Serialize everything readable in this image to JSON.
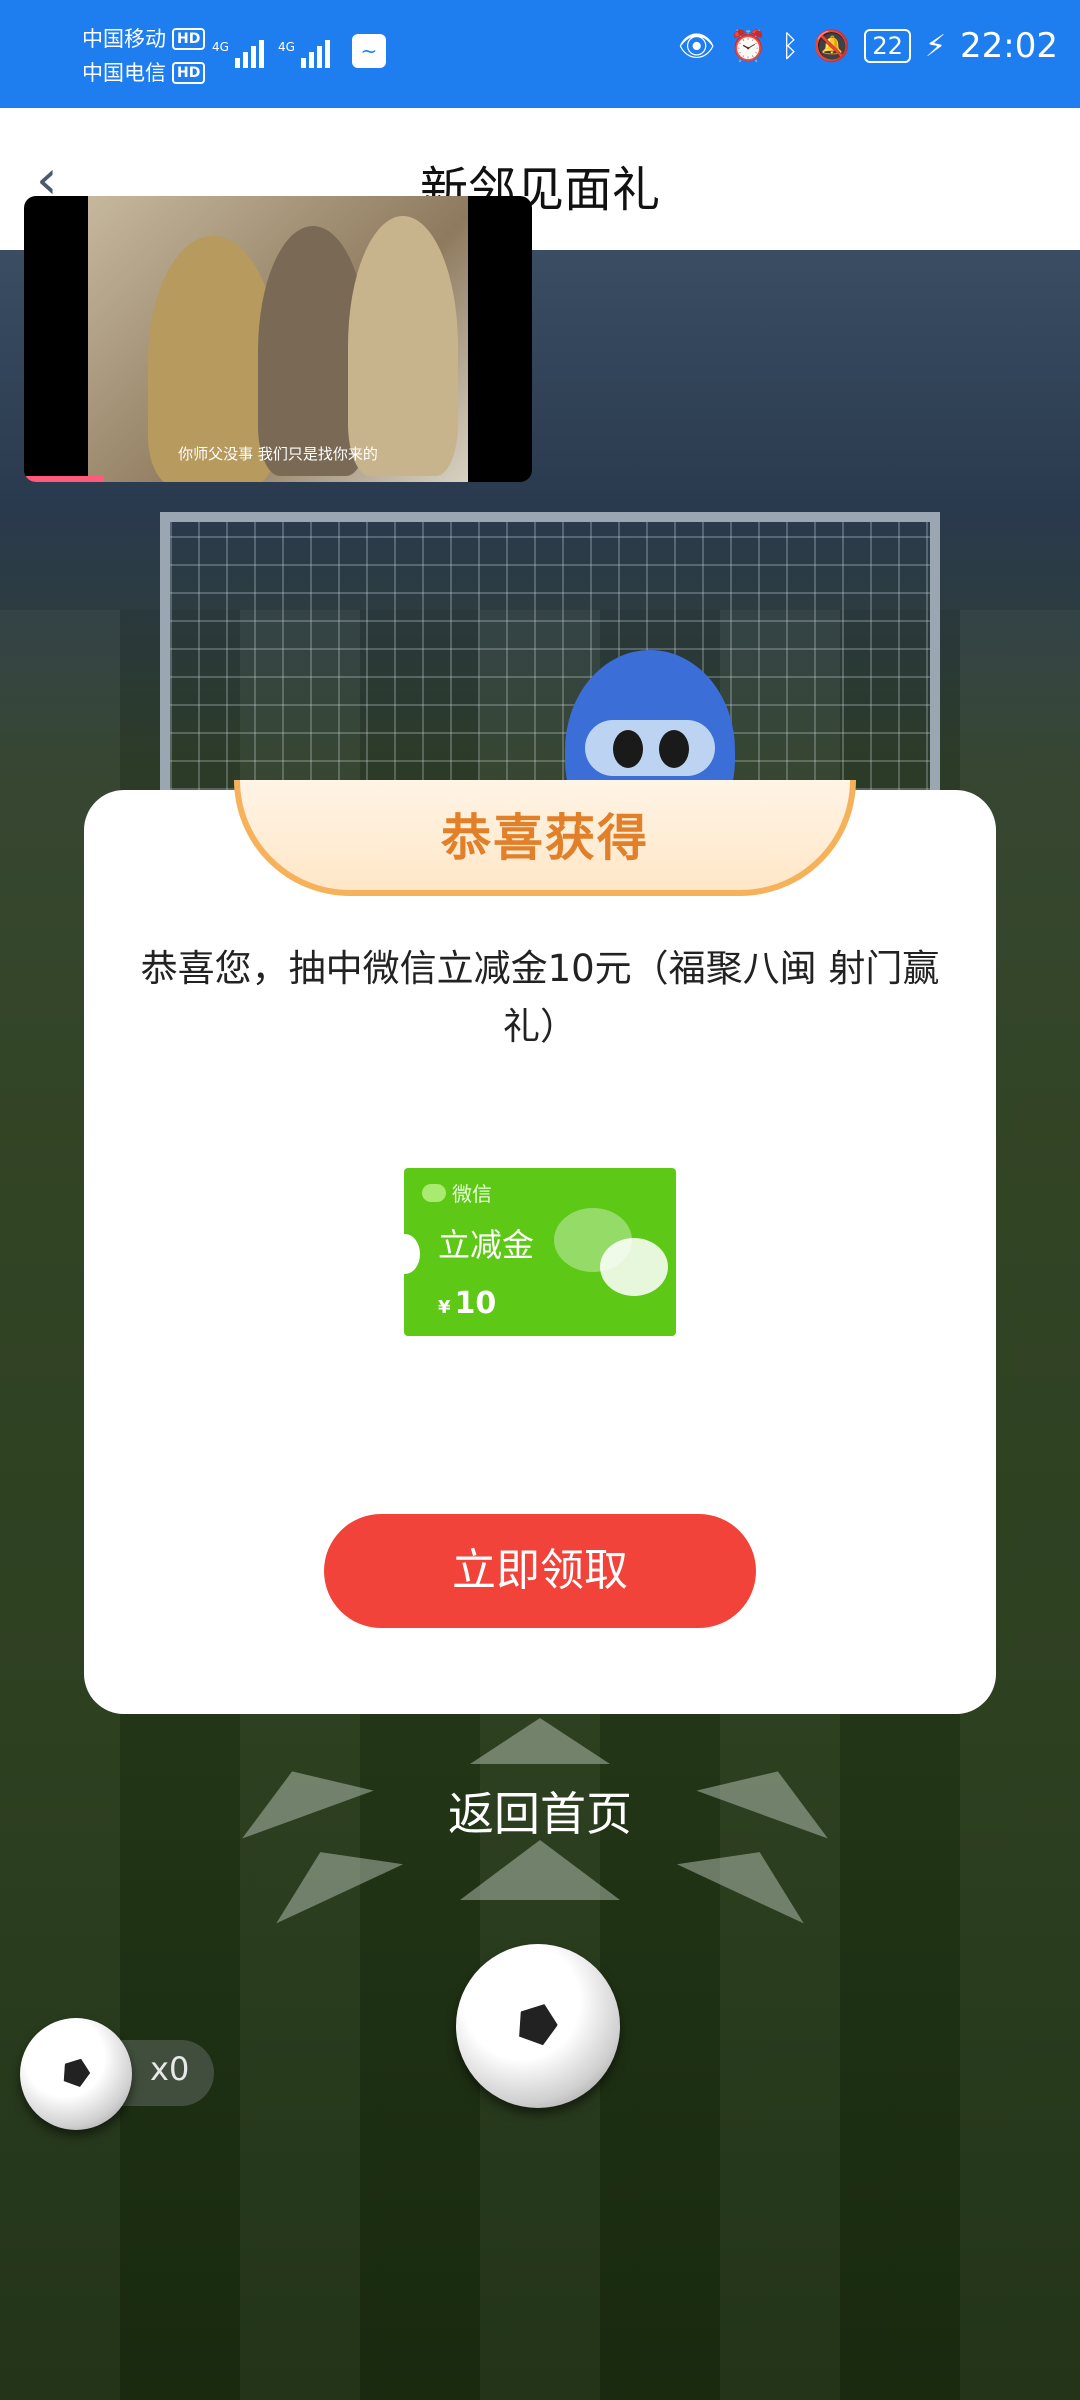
{
  "status_bar": {
    "carrier_1": "中国移动",
    "carrier_2": "中国电信",
    "hd": "HD",
    "network": "4G",
    "battery": "22",
    "time": "22:02",
    "icons": [
      "eye-icon",
      "alarm-icon",
      "bluetooth-icon",
      "mute-bell-icon",
      "battery-icon",
      "charging-icon"
    ]
  },
  "nav": {
    "back_icon": "chevron-left-icon",
    "title": "新邻见面礼"
  },
  "video": {
    "subtitle": "你师父没事 我们只是找你来的"
  },
  "modal": {
    "header": "恭喜获得",
    "message": "恭喜您，抽中微信立减金10元（福聚八闽 射门赢礼）",
    "coupon": {
      "brand": "微信",
      "type": "立减金",
      "currency": "¥",
      "amount": "10"
    },
    "claim_button": "立即领取"
  },
  "home_link": "返回首页",
  "ball_counter": "x0",
  "colors": {
    "status_bar": "#1e7ef0",
    "button": "#f2433a",
    "coupon": "#5dc816",
    "ribbon_text": "#e2802a"
  }
}
